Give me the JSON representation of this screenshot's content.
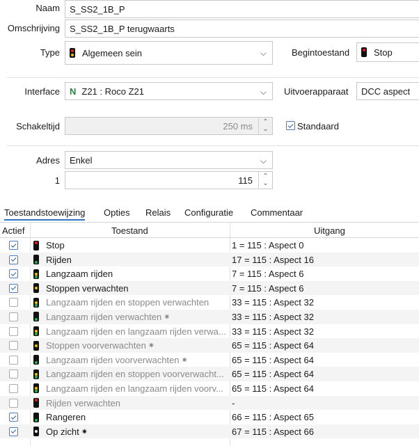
{
  "form": {
    "naam_label": "Naam",
    "naam_value": "S_SS2_1B_P",
    "omschrijving_label": "Omschrijving",
    "omschrijving_value": "S_SS2_1B_P terugwaarts",
    "type_label": "Type",
    "type_value": "Algemeen sein",
    "begintoestand_label": "Begintoestand",
    "begintoestand_value": "Stop",
    "interface_label": "Interface",
    "interface_prefix": "N",
    "interface_value": "Z21 : Roco Z21",
    "uitvoer_label": "Uitvoerapparaat",
    "uitvoer_value": "DCC aspect",
    "schakeltijd_label": "Schakeltijd",
    "schakeltijd_value": "250 ms",
    "standaard_label": "Standaard",
    "standaard_checked": true,
    "adres_label": "Adres",
    "adres_value": "Enkel",
    "adres1_label": "1",
    "adres1_value": "115"
  },
  "tabs": [
    {
      "label": "Toestandstoewijzing",
      "active": true
    },
    {
      "label": "Opties"
    },
    {
      "label": "Relais"
    },
    {
      "label": "Configuratie"
    },
    {
      "label": "Commentaar"
    }
  ],
  "table": {
    "headers": {
      "actief": "Actief",
      "toestand": "Toestand",
      "uitgang": "Uitgang"
    },
    "rows": [
      {
        "checked": true,
        "toestand": "Stop",
        "uitgang": "1 = 115 : Aspect 0",
        "lights": [
          "red"
        ],
        "sun": false
      },
      {
        "checked": true,
        "toestand": "Rijden",
        "uitgang": "17 = 115 : Aspect 16",
        "lights": [
          "green"
        ],
        "sun": false
      },
      {
        "checked": true,
        "toestand": "Langzaam rijden",
        "uitgang": "7 = 115 : Aspect 6",
        "lights": [
          "yellow",
          "green"
        ],
        "sun": false
      },
      {
        "checked": true,
        "toestand": "Stoppen verwachten",
        "uitgang": "7 = 115 : Aspect 6",
        "lights": [
          "yellow"
        ],
        "sun": false
      },
      {
        "checked": false,
        "toestand": "Langzaam rijden en stoppen verwachten",
        "uitgang": "33 = 115 : Aspect 32",
        "lights": [
          "yellow",
          "green"
        ],
        "sun": false
      },
      {
        "checked": false,
        "toestand": "Langzaam rijden verwachten",
        "uitgang": "33 = 115 : Aspect 32",
        "lights": [
          "green"
        ],
        "sun": true
      },
      {
        "checked": false,
        "toestand": "Langzaam rijden en langzaam rijden verwa...",
        "uitgang": "33 = 115 : Aspect 32",
        "lights": [
          "yellow",
          "green"
        ],
        "sun": false
      },
      {
        "checked": false,
        "toestand": "Stoppen voorverwachten",
        "uitgang": "65 = 115 : Aspect 64",
        "lights": [
          "yellow"
        ],
        "sun": true
      },
      {
        "checked": false,
        "toestand": "Langzaam rijden voorverwachten",
        "uitgang": "65 = 115 : Aspect 64",
        "lights": [
          "green"
        ],
        "sun": true
      },
      {
        "checked": false,
        "toestand": "Langzaam rijden en stoppen voorverwacht...",
        "uitgang": "65 = 115 : Aspect 64",
        "lights": [
          "yellow",
          "green"
        ],
        "sun": false
      },
      {
        "checked": false,
        "toestand": "Langzaam rijden en langzaam rijden voorv...",
        "uitgang": "65 = 115 : Aspect 64",
        "lights": [
          "yellow",
          "green"
        ],
        "sun": false
      },
      {
        "checked": false,
        "toestand": "Rijden verwachten",
        "uitgang": "-",
        "lights": [
          "red"
        ],
        "sun": false
      },
      {
        "checked": true,
        "toestand": "Rangeren",
        "uitgang": "66 = 115 : Aspect 65",
        "lights": [
          "green"
        ],
        "sun": false
      },
      {
        "checked": true,
        "toestand": "Op zicht",
        "uitgang": "67 = 115 : Aspect 66",
        "lights": [
          "white"
        ],
        "sun": true
      }
    ]
  },
  "colors": {
    "red": "#e02020",
    "green": "#2bb24c",
    "yellow": "#f2c200",
    "white": "#ffffff",
    "accent": "#2f74c0",
    "interface_n": "#1f8a3a"
  },
  "icons": {
    "signal": "signal-icon",
    "sun": "sun-icon",
    "chevron": "chevron-down-icon"
  }
}
